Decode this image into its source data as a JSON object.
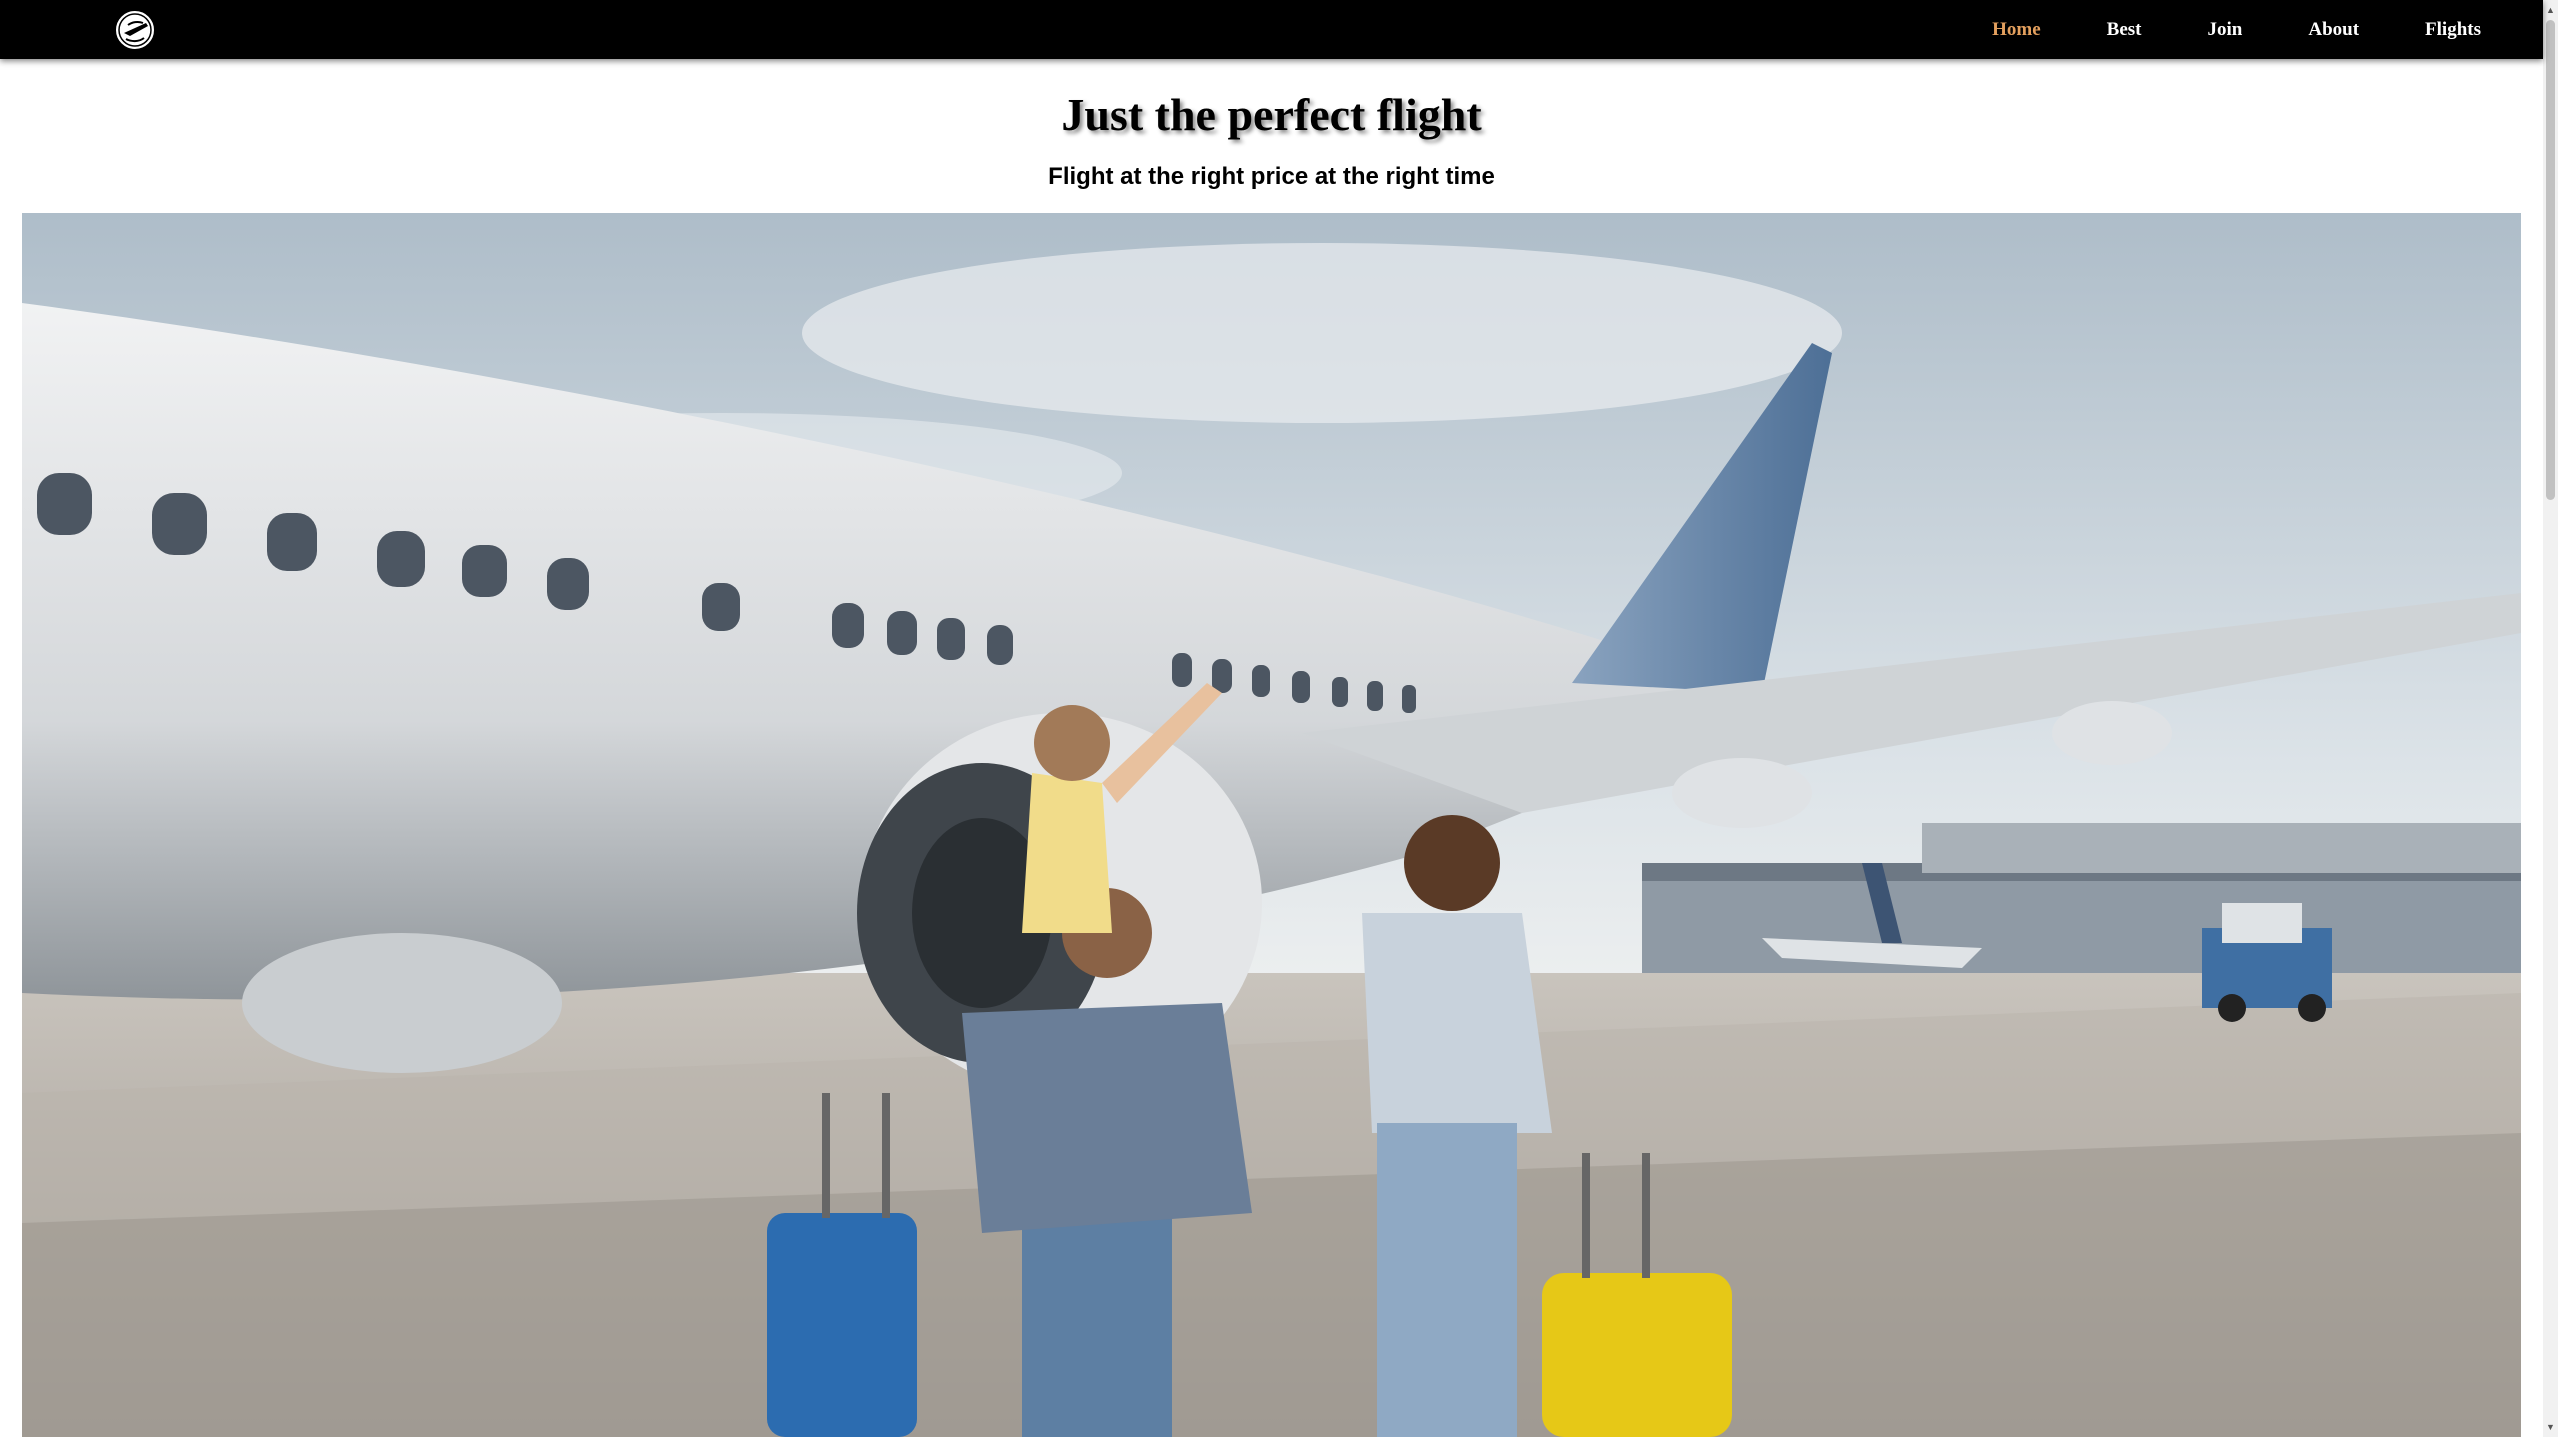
{
  "nav": {
    "items": [
      {
        "label": "Home",
        "active": true
      },
      {
        "label": "Best",
        "active": false
      },
      {
        "label": "Join",
        "active": false
      },
      {
        "label": "About",
        "active": false
      },
      {
        "label": "Flights",
        "active": false
      }
    ]
  },
  "hero": {
    "title": "Just the perfect flight",
    "subtitle": "Flight at the right price at the right time"
  },
  "colors": {
    "nav_background": "#000000",
    "nav_text": "#ffffff",
    "nav_active": "#e4a05e",
    "page_background": "#ffffff"
  },
  "icons": {
    "logo": "globe-plane-icon"
  }
}
